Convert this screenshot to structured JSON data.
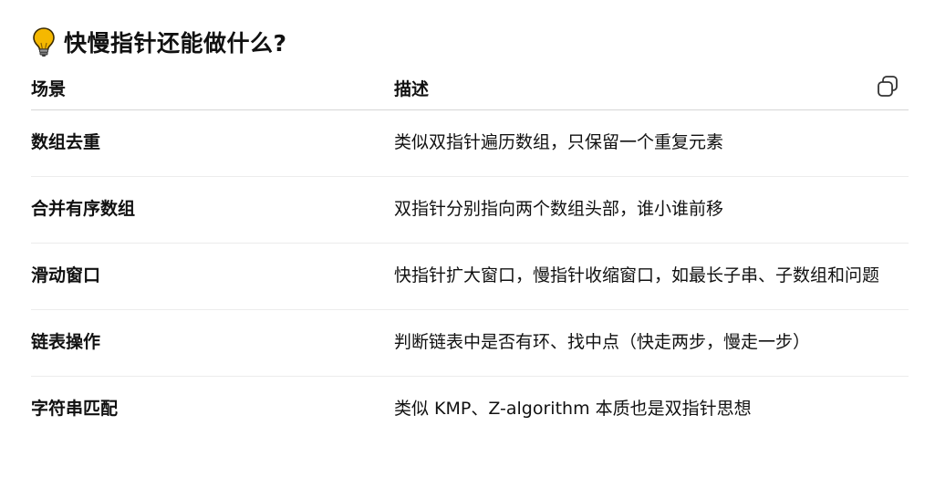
{
  "heading": {
    "icon": "lightbulb-icon",
    "text": "快慢指针还能做什么?"
  },
  "table": {
    "headers": [
      "场景",
      "描述"
    ],
    "rows": [
      {
        "scene": "数组去重",
        "description": "类似双指针遍历数组，只保留一个重复元素"
      },
      {
        "scene": "合并有序数组",
        "description": "双指针分别指向两个数组头部，谁小谁前移"
      },
      {
        "scene": "滑动窗口",
        "description": "快指针扩大窗口，慢指针收缩窗口，如最长子串、子数组和问题"
      },
      {
        "scene": "链表操作",
        "description": "判断链表中是否有环、找中点（快走两步，慢走一步）"
      },
      {
        "scene": "字符串匹配",
        "description": "类似 KMP、Z-algorithm 本质也是双指针思想"
      }
    ]
  },
  "toolbar": {
    "copy_icon": "copy-icon"
  },
  "colors": {
    "bulb": "#f5b800",
    "text": "#111111",
    "divider": "#e6e6e6"
  }
}
